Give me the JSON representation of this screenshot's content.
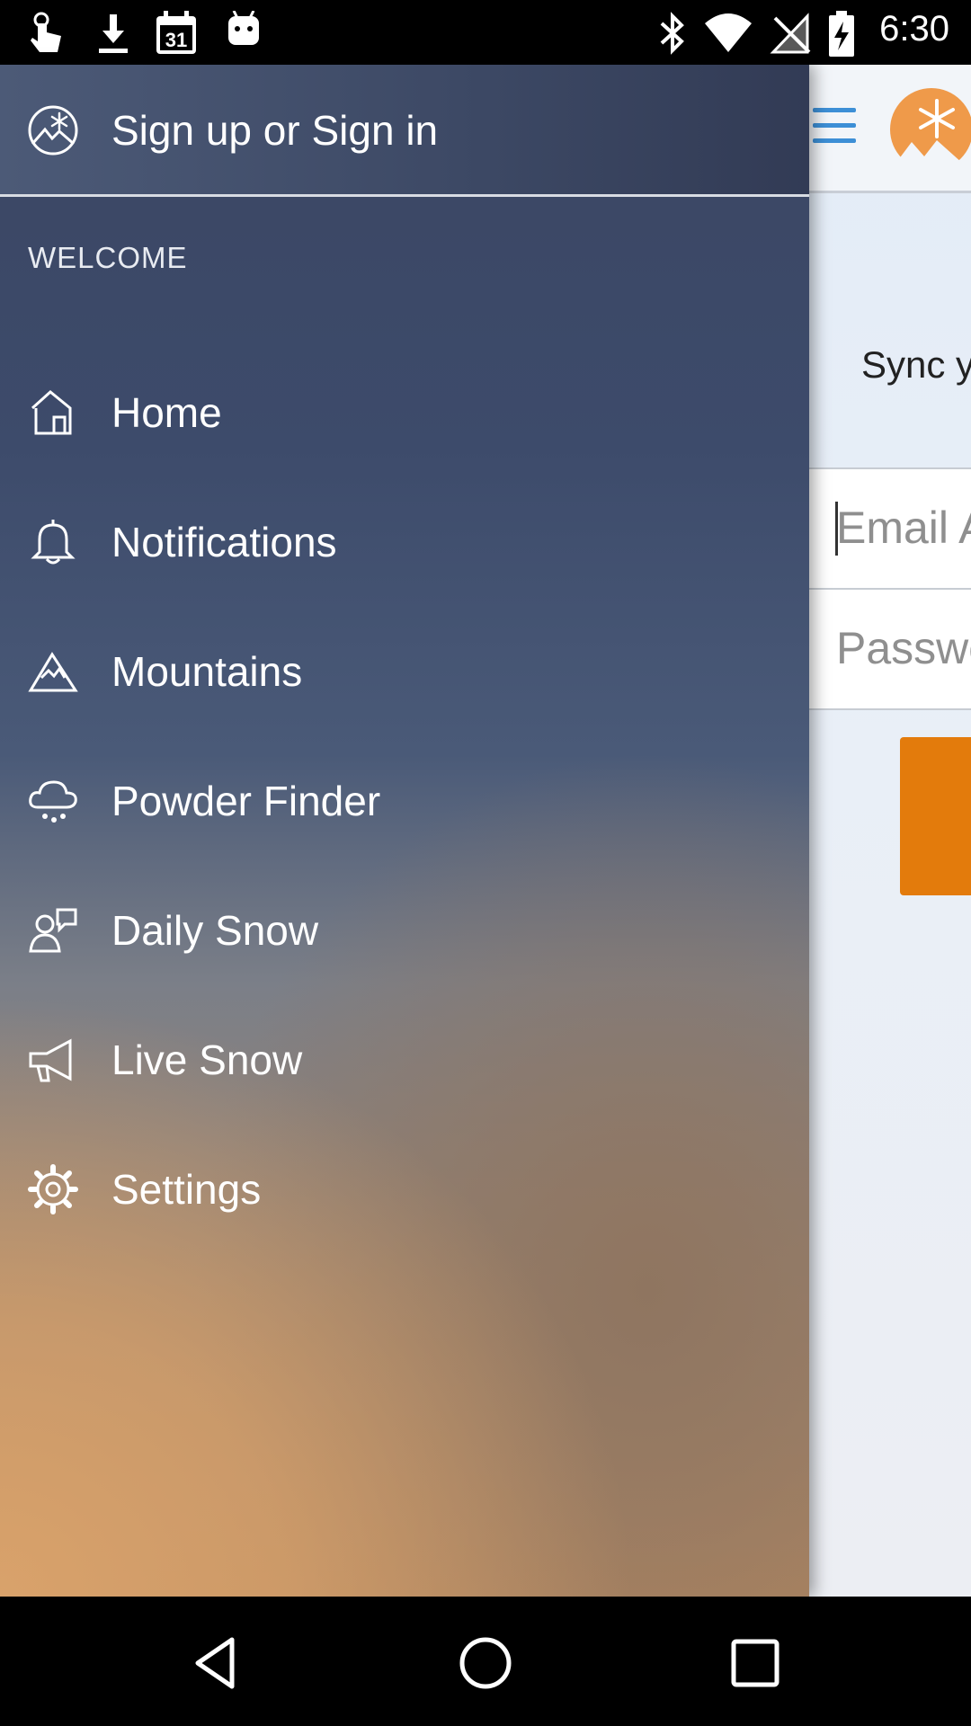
{
  "status_bar": {
    "time": "6:30",
    "left_icons": [
      "touch-icon",
      "download-icon",
      "calendar-icon",
      "android-icon"
    ],
    "calendar_day": "31",
    "right_icons": [
      "bluetooth-icon",
      "wifi-icon",
      "no-signal-icon",
      "battery-charging-icon"
    ]
  },
  "app": {
    "sync_text": "Sync y",
    "email_placeholder": "Email A",
    "password_placeholder": "Passwo",
    "accent_color": "#e37b0c",
    "hamburger_color": "#3d8fd6"
  },
  "drawer": {
    "header": {
      "label": "Sign up or Sign in",
      "icon": "snow-mountain-logo-icon"
    },
    "section_label": "WELCOME",
    "items": [
      {
        "label": "Home",
        "icon": "home-icon"
      },
      {
        "label": "Notifications",
        "icon": "bell-icon"
      },
      {
        "label": "Mountains",
        "icon": "mountain-icon"
      },
      {
        "label": "Powder Finder",
        "icon": "snow-cloud-icon"
      },
      {
        "label": "Daily Snow",
        "icon": "person-chat-icon"
      },
      {
        "label": "Live Snow",
        "icon": "megaphone-icon"
      },
      {
        "label": "Settings",
        "icon": "gear-icon"
      }
    ]
  },
  "nav_bar": {
    "buttons": [
      "back-icon",
      "home-circle-icon",
      "recents-icon"
    ]
  }
}
